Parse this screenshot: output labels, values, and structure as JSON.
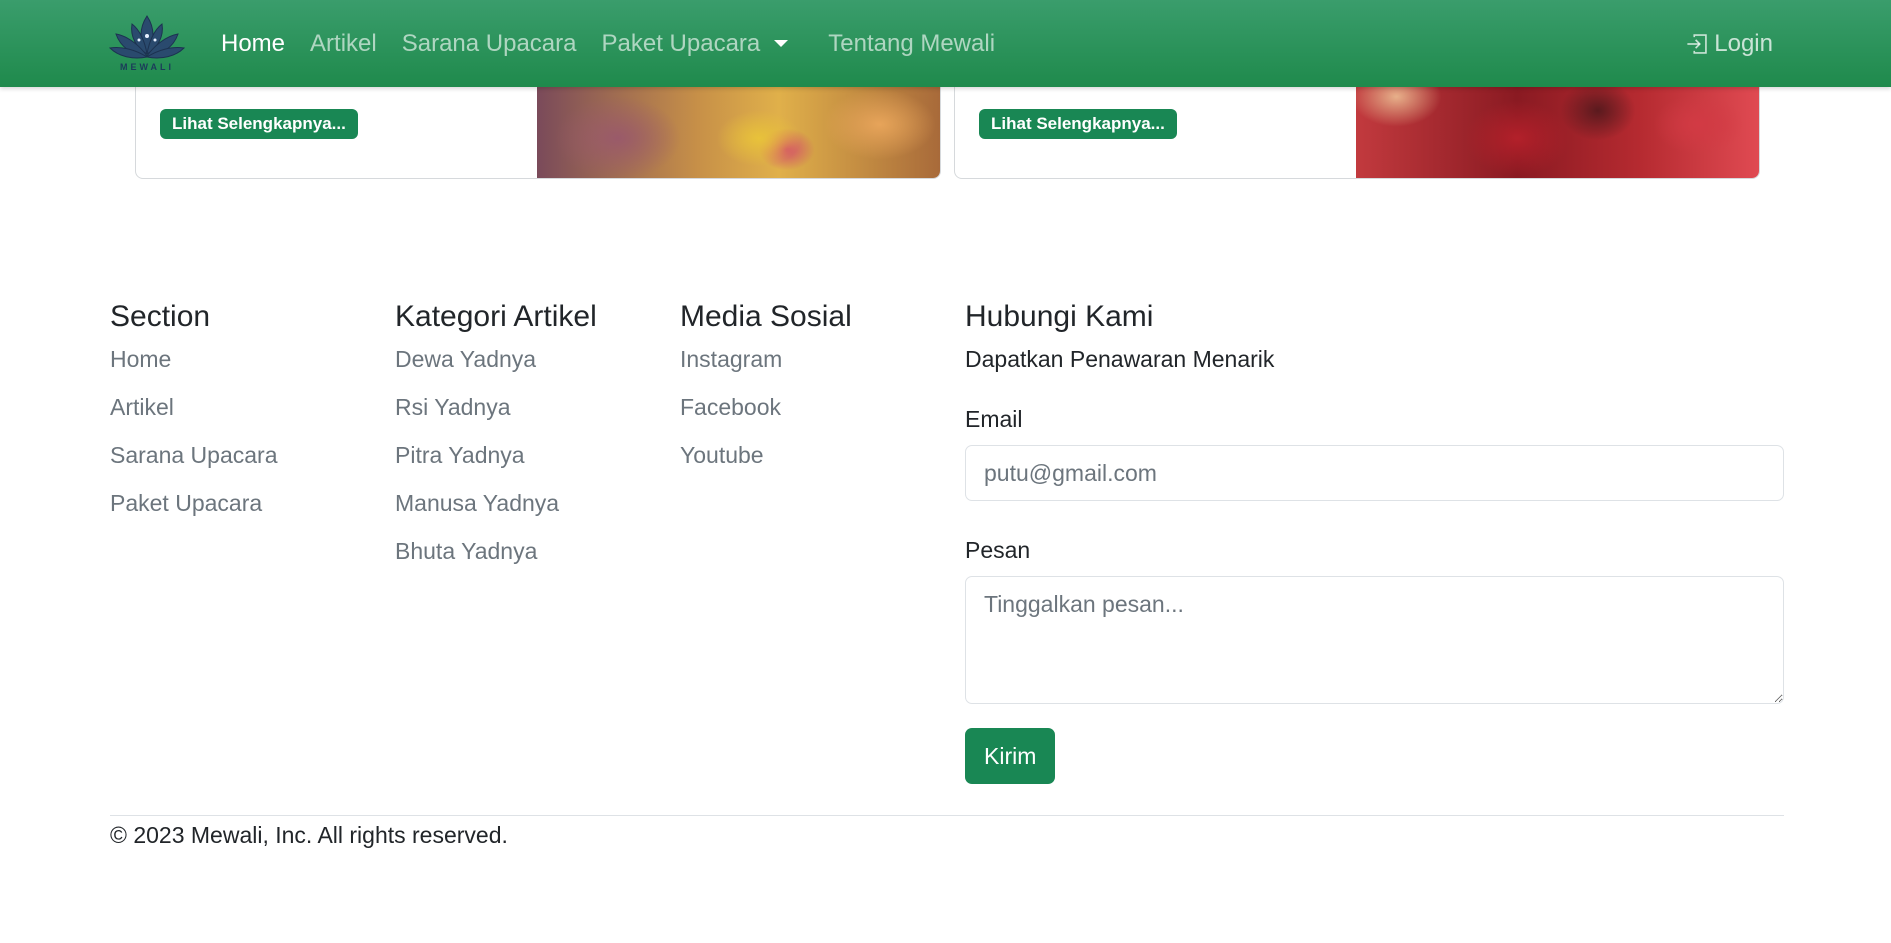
{
  "brand": {
    "logo_text": "MEWALI"
  },
  "nav": {
    "links": [
      "Home",
      "Artikel",
      "Sarana Upacara",
      "Paket Upacara",
      "Tentang Mewali"
    ],
    "login": "Login"
  },
  "cards": [
    {
      "button": "Lihat Selengkapnya..."
    },
    {
      "button": "Lihat Selengkapnya..."
    }
  ],
  "footer": {
    "section": {
      "title": "Section",
      "links": [
        "Home",
        "Artikel",
        "Sarana Upacara",
        "Paket Upacara"
      ]
    },
    "kategori": {
      "title": "Kategori Artikel",
      "links": [
        "Dewa Yadnya",
        "Rsi Yadnya",
        "Pitra Yadnya",
        "Manusa Yadnya",
        "Bhuta Yadnya"
      ]
    },
    "media": {
      "title": "Media Sosial",
      "links": [
        "Instagram",
        "Facebook",
        "Youtube"
      ]
    },
    "contact": {
      "title": "Hubungi Kami",
      "promo": "Dapatkan Penawaran Menarik",
      "email_label": "Email",
      "email_placeholder": "putu@gmail.com",
      "message_label": "Pesan",
      "message_placeholder": "Tinggalkan pesan...",
      "submit": "Kirim"
    },
    "copyright": "© 2023 Mewali, Inc. All rights reserved."
  },
  "colors": {
    "primary": "#198754",
    "navbar": "#2a9560",
    "muted": "#6c757d"
  },
  "icons": {
    "login": "box-arrow-in-right-icon",
    "dropdown": "caret-down-icon",
    "logo": "lotus-logo-icon"
  }
}
